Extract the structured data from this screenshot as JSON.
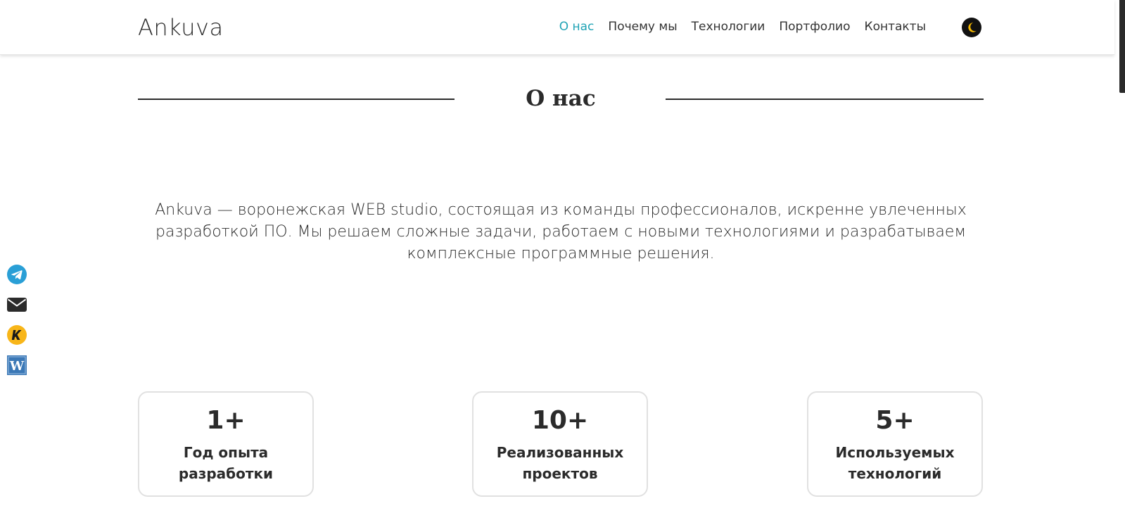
{
  "header": {
    "logo": "Ankuva",
    "nav": [
      {
        "label": "О нас",
        "active": true
      },
      {
        "label": "Почему мы",
        "active": false
      },
      {
        "label": "Технологии",
        "active": false
      },
      {
        "label": "Портфолио",
        "active": false
      },
      {
        "label": "Контакты",
        "active": false
      }
    ],
    "theme_toggle_icon": "moon-icon"
  },
  "about": {
    "title": "О нас",
    "text": "Ankuva — воронежская WEB studio, состоящая из команды профессионалов, искренне увлеченных разработкой ПО. Мы решаем сложные задачи, работаем с новыми технологиями и разрабатываем комплексные программные решения."
  },
  "social": [
    {
      "icon": "telegram-icon"
    },
    {
      "icon": "email-icon"
    },
    {
      "icon": "kwork-icon"
    },
    {
      "icon": "w-icon"
    }
  ],
  "stats": [
    {
      "value": "1+",
      "label_line1": "Год опыта",
      "label_line2": "разработки"
    },
    {
      "value": "10+",
      "label_line1": "Реализованных",
      "label_line2": "проектов"
    },
    {
      "value": "5+",
      "label_line1": "Используемых",
      "label_line2": "технологий"
    }
  ],
  "colors": {
    "accent": "#20a3b5",
    "text": "#2b2b2b",
    "telegram": "#2a9fd6",
    "kwork": "#f8b619",
    "w_badge": "#3b78b6"
  }
}
